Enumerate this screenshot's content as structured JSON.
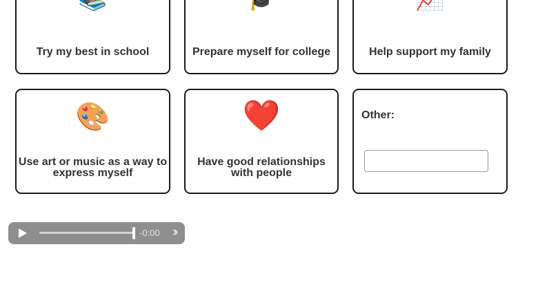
{
  "cards": [
    {
      "label": "Try my best in school",
      "emoji": "📚"
    },
    {
      "label": "Prepare myself for college",
      "emoji": "🎓"
    },
    {
      "label": "Help support my family",
      "emoji": "📈"
    },
    {
      "label": "Use art or music as a way to express myself",
      "emoji": "🎨"
    },
    {
      "label": "Have good relationships with people",
      "emoji": "❤️"
    }
  ],
  "other": {
    "label": "Other:",
    "value": ""
  },
  "audio": {
    "time": "-0:00",
    "play_icon": "play-icon",
    "more_icon": "chevrons-right-icon",
    "progress": 1.0
  },
  "colors": {
    "card_border": "#1a1a1a",
    "player_bg": "#8e8e8e",
    "text": "#333333"
  }
}
